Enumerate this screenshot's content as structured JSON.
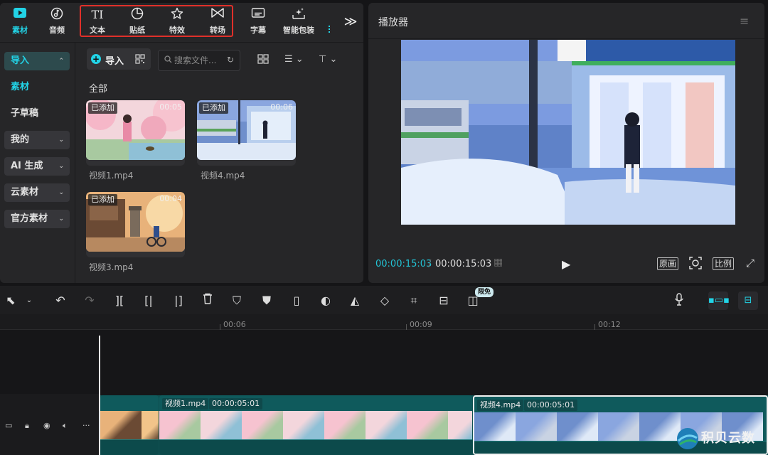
{
  "top_tabs": [
    {
      "label": "素材",
      "icon": "play-square-icon",
      "active": true
    },
    {
      "label": "音频",
      "icon": "music-note-icon",
      "active": false
    },
    {
      "label": "文本",
      "icon": "text-icon",
      "active": false
    },
    {
      "label": "贴纸",
      "icon": "sticker-icon",
      "active": false
    },
    {
      "label": "特效",
      "icon": "sparkle-star-icon",
      "active": false
    },
    {
      "label": "转场",
      "icon": "transition-bowtie-icon",
      "active": false
    },
    {
      "label": "字幕",
      "icon": "subtitle-icon",
      "active": false
    },
    {
      "label": "智能包装",
      "icon": "smart-pack-icon",
      "active": false
    }
  ],
  "sidebar": {
    "items": [
      {
        "label": "导入",
        "expandable": true,
        "selected": true
      },
      {
        "label": "素材",
        "expandable": false,
        "selected": true
      },
      {
        "label": "子草稿",
        "expandable": false,
        "selected": false
      },
      {
        "label": "我的",
        "expandable": true,
        "selected": false
      },
      {
        "label": "AI 生成",
        "expandable": true,
        "selected": false
      },
      {
        "label": "云素材",
        "expandable": true,
        "selected": false
      },
      {
        "label": "官方素材",
        "expandable": true,
        "selected": false
      }
    ]
  },
  "media": {
    "import_label": "导入",
    "search_placeholder": "搜索文件...",
    "section_label": "全部",
    "cards": [
      {
        "badge": "已添加",
        "duration": "00:05",
        "name": "视频1.mp4"
      },
      {
        "badge": "已添加",
        "duration": "00:06",
        "name": "视频4.mp4"
      },
      {
        "badge": "已添加",
        "duration": "00:04",
        "name": "视频3.mp4"
      }
    ]
  },
  "player": {
    "title": "播放器",
    "time_current": "00:00:15:03",
    "time_separator": "/",
    "time_total": "00:00:15:03",
    "btn_original": "原画",
    "btn_ratio": "比例"
  },
  "toolbar": {
    "limited_badge": "限免"
  },
  "ruler": {
    "ticks": [
      "00:06",
      "00:09",
      "00:12"
    ]
  },
  "timeline": {
    "clips": [
      {
        "name": "视频1.mp4",
        "duration": "00:00:05:01"
      },
      {
        "name": "视频4.mp4",
        "duration": "00:00:05:01"
      }
    ]
  },
  "watermark": {
    "text": "积贝云数"
  },
  "colors": {
    "accent": "#22d3e6",
    "highlight_box": "#e0302a",
    "clip_bg": "#0f5a5c"
  }
}
